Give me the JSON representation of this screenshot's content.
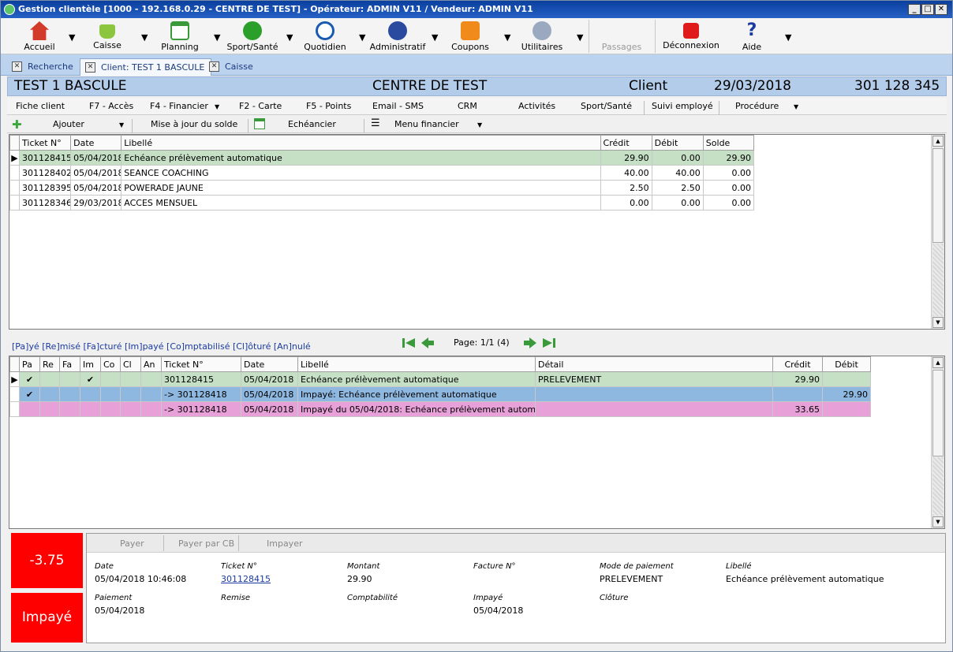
{
  "window": {
    "title": "Gestion clientèle [1000 - 192.168.0.29 - CENTRE DE TEST] - Opérateur: ADMIN V11 / Vendeur: ADMIN V11"
  },
  "toolbar": {
    "accueil": "Accueil",
    "caisse": "Caisse",
    "planning": "Planning",
    "sport": "Sport/Santé",
    "quotidien": "Quotidien",
    "administratif": "Administratif",
    "coupons": "Coupons",
    "utilitaires": "Utilitaires",
    "passages": "Passages",
    "deconnexion": "Déconnexion",
    "aide": "Aide"
  },
  "tabs": {
    "recherche": "Recherche",
    "client": "Client: TEST 1 BASCULE",
    "caisse": "Caisse"
  },
  "client": {
    "name": "TEST 1 BASCULE",
    "centre": "CENTRE DE TEST",
    "type": "Client",
    "date": "29/03/2018",
    "number": "301 128 345"
  },
  "menu": {
    "fiche": "Fiche client",
    "acces": "F7 - Accès",
    "financier": "F4 - Financier",
    "carte": "F2 - Carte",
    "points": "F5 - Points",
    "email": "Email - SMS",
    "crm": "CRM",
    "activites": "Activités",
    "sport": "Sport/Santé",
    "suivi": "Suivi employé",
    "procedure": "Procédure"
  },
  "actions": {
    "ajouter": "Ajouter",
    "maj": "Mise à jour du solde",
    "echeancier": "Echéancier",
    "menu_fin": "Menu financier"
  },
  "grid1": {
    "headers": {
      "ticket": "Ticket N°",
      "date": "Date",
      "libelle": "Libellé",
      "credit": "Crédit",
      "debit": "Débit",
      "solde": "Solde"
    },
    "rows": [
      {
        "ticket": "301128415",
        "date": "05/04/2018",
        "libelle": "Echéance prélèvement automatique",
        "credit": "29.90",
        "debit": "0.00",
        "solde": "29.90"
      },
      {
        "ticket": "301128402",
        "date": "05/04/2018",
        "libelle": "SEANCE COACHING",
        "credit": "40.00",
        "debit": "40.00",
        "solde": "0.00"
      },
      {
        "ticket": "301128395",
        "date": "05/04/2018",
        "libelle": "POWERADE JAUNE",
        "credit": "2.50",
        "debit": "2.50",
        "solde": "0.00"
      },
      {
        "ticket": "301128346",
        "date": "29/03/2018",
        "libelle": "ACCES MENSUEL",
        "credit": "0.00",
        "debit": "0.00",
        "solde": "0.00"
      }
    ]
  },
  "legend": "[Pa]yé [Re]misé [Fa]cturé [Im]payé [Co]mptabilisé [Cl]ôturé [An]nulé",
  "pager": {
    "text": "Page: 1/1 (4)"
  },
  "grid2": {
    "headers": {
      "pa": "Pa",
      "re": "Re",
      "fa": "Fa",
      "im": "Im",
      "co": "Co",
      "cl": "Cl",
      "an": "An",
      "ticket": "Ticket N°",
      "date": "Date",
      "libelle": "Libellé",
      "detail": "Détail",
      "credit": "Crédit",
      "debit": "Débit"
    },
    "rows": [
      {
        "pa": "✔",
        "im": "✔",
        "ticket": "301128415",
        "date": "05/04/2018",
        "libelle": "Echéance prélèvement automatique",
        "detail": "PRELEVEMENT",
        "credit": "29.90",
        "debit": ""
      },
      {
        "pa": "✔",
        "im": "",
        "ticket": "-> 301128418",
        "date": "05/04/2018",
        "libelle": "Impayé: Echéance prélèvement automatique",
        "detail": "",
        "credit": "",
        "debit": "29.90"
      },
      {
        "pa": "",
        "im": "",
        "ticket": "-> 301128418",
        "date": "05/04/2018",
        "libelle": "Impayé du 05/04/2018: Echéance prélèvement automat",
        "detail": "",
        "credit": "33.65",
        "debit": ""
      }
    ]
  },
  "status": {
    "amount": "-3.75",
    "label": "Impayé"
  },
  "detail": {
    "buttons": {
      "payer": "Payer",
      "payer_cb": "Payer par CB",
      "impayer": "Impayer"
    },
    "labels": {
      "date": "Date",
      "ticket": "Ticket N°",
      "montant": "Montant",
      "facture": "Facture N°",
      "mode": "Mode de paiement",
      "libelle": "Libellé",
      "paiement": "Paiement",
      "remise": "Remise",
      "compta": "Comptabilité",
      "impaye": "Impayé",
      "cloture": "Clôture"
    },
    "values": {
      "date": "05/04/2018 10:46:08",
      "ticket": "301128415",
      "montant": "29.90",
      "mode": "PRELEVEMENT",
      "libelle": "Echéance prélèvement automatique",
      "paiement": "05/04/2018",
      "impaye": "05/04/2018"
    }
  },
  "colors": {
    "title_bar": "#0a3f9e",
    "row_green": "#c6e0c6",
    "row_blue": "#8fb8e0",
    "row_pink": "#e8a0d8",
    "status_red": "#ff0000"
  }
}
